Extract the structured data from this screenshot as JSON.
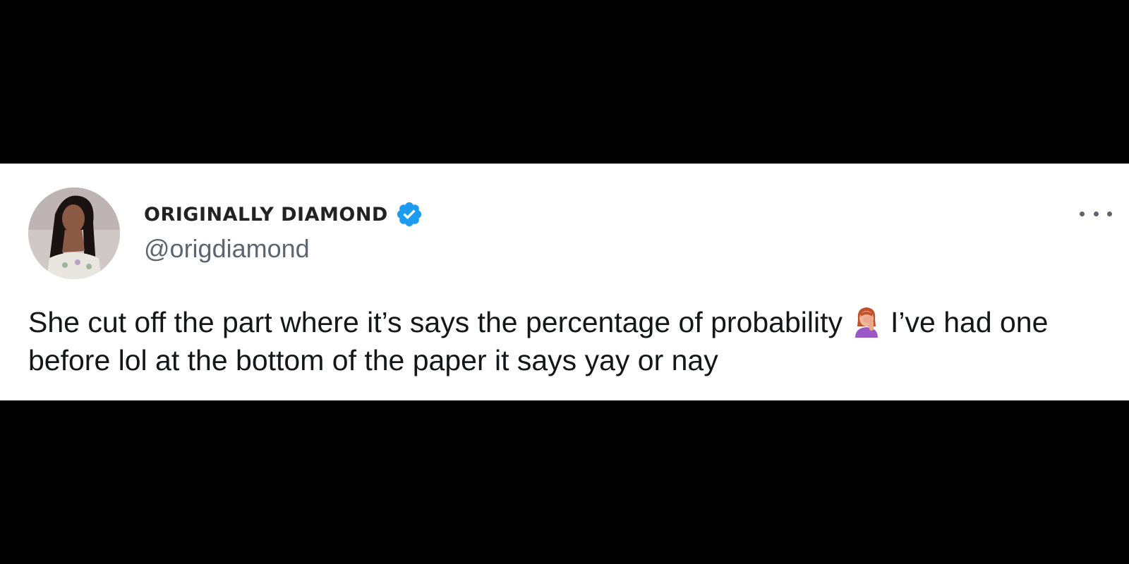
{
  "tweet": {
    "author": {
      "display_name": "ORIGINALLY DIAMOND",
      "handle": "@origdiamond",
      "verified": true,
      "verified_badge_color": "#1d9bf0"
    },
    "text_part1": "She cut off the part where it’s says the percentage of probability",
    "emoji": "woman-facepalming-icon",
    "text_part2": "I’ve had one before lol at the bottom of the paper it says yay or nay",
    "more_menu_icon": "ellipsis-icon"
  },
  "colors": {
    "background": "#000000",
    "card": "#ffffff",
    "text": "#14171a",
    "secondary_text": "#5b6670"
  }
}
